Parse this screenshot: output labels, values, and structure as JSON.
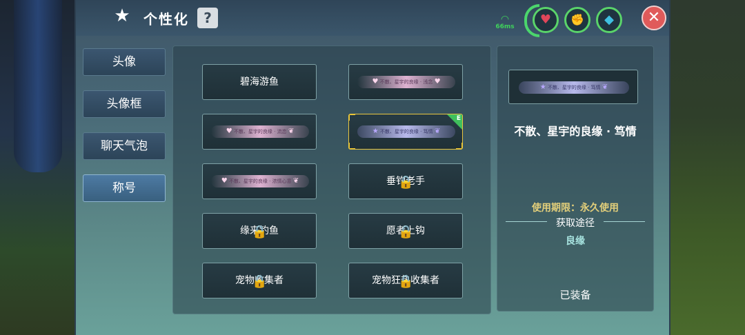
{
  "header": {
    "title": "个性化",
    "help_label": "?",
    "ping": "66ms",
    "close_label": "✕",
    "stats": [
      {
        "icon": "heart-icon",
        "glyph": "♥",
        "color": "#e0465a"
      },
      {
        "icon": "muscle-icon",
        "glyph": "💪",
        "color": "#f0b020"
      },
      {
        "icon": "water-drop-icon",
        "glyph": "💧",
        "color": "#40c0e0"
      }
    ]
  },
  "tabs": [
    {
      "label": "头像",
      "active": false
    },
    {
      "label": "头像框",
      "active": false
    },
    {
      "label": "聊天气泡",
      "active": false
    },
    {
      "label": "称号",
      "active": true
    }
  ],
  "titles": [
    {
      "label": "碧海游鱼",
      "locked": false
    },
    {
      "label": "不散、星宇的良缘 · 浅念",
      "locked": false
    },
    {
      "label": "不散、星宇的良缘 · 流恋",
      "locked": false
    },
    {
      "label": "不散、星宇的良缘 · 笃情",
      "locked": false,
      "selected": true,
      "equipped_tag": "E"
    },
    {
      "label": "不散、星宇的良缘 · 浓情心意",
      "locked": false
    },
    {
      "label": "垂钓老手",
      "locked": true
    },
    {
      "label": "缘来钓鱼",
      "locked": true
    },
    {
      "label": "愿者上钩",
      "locked": true
    },
    {
      "label": "宠物收集者",
      "locked": true
    },
    {
      "label": "宠物狂热收集者",
      "locked": true
    }
  ],
  "detail": {
    "name": "不散、星宇的良缘 · 笃情",
    "duration": "使用期限：永久使用",
    "source_label": "获取途径",
    "source_value": "良缘",
    "status": "已装备"
  }
}
